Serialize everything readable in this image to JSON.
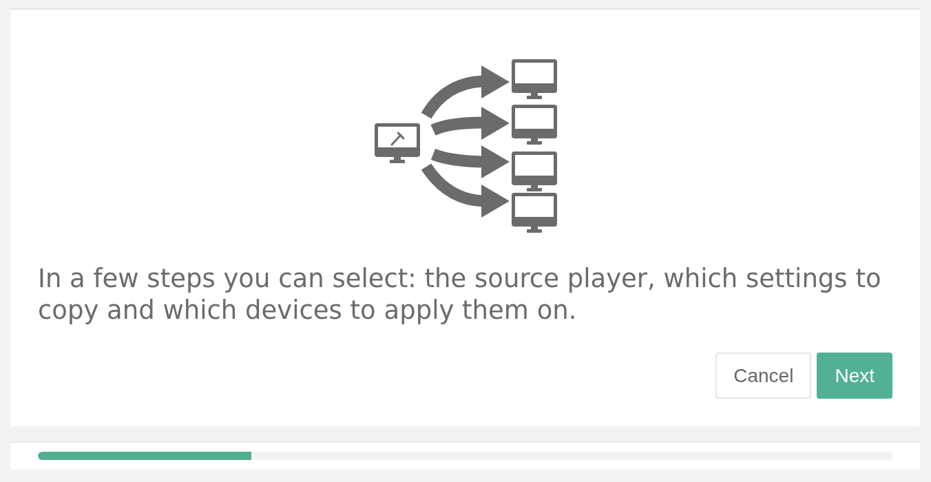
{
  "intro": {
    "text": "In a few steps you can select: the source player, which settings to copy and which devices to apply them on."
  },
  "buttons": [
    {
      "label": "Cancel",
      "kind": "secondary"
    },
    {
      "label": "Next",
      "kind": "primary"
    }
  ],
  "progress": {
    "level": 0.25
  }
}
